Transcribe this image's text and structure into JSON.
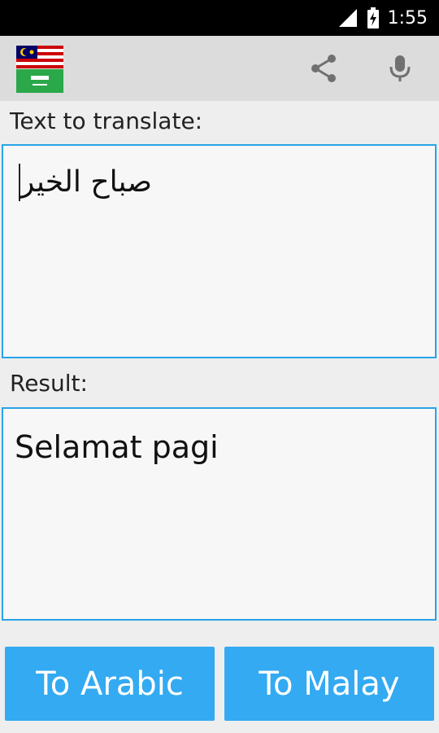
{
  "status_bar": {
    "time": "1:55"
  },
  "app_bar": {
    "icons": [
      "malaysia-flag-icon",
      "saudi-flag-icon",
      "share-icon",
      "microphone-icon"
    ]
  },
  "source": {
    "label": "Text to translate:",
    "value": "صباح الخير"
  },
  "result": {
    "label": "Result:",
    "value": "Selamat pagi"
  },
  "buttons": {
    "to_arabic": "To Arabic",
    "to_malay": "To Malay"
  },
  "colors": {
    "accent": "#33aaf2",
    "box_border": "#29a3e6",
    "app_bar": "#dcdcdc"
  }
}
